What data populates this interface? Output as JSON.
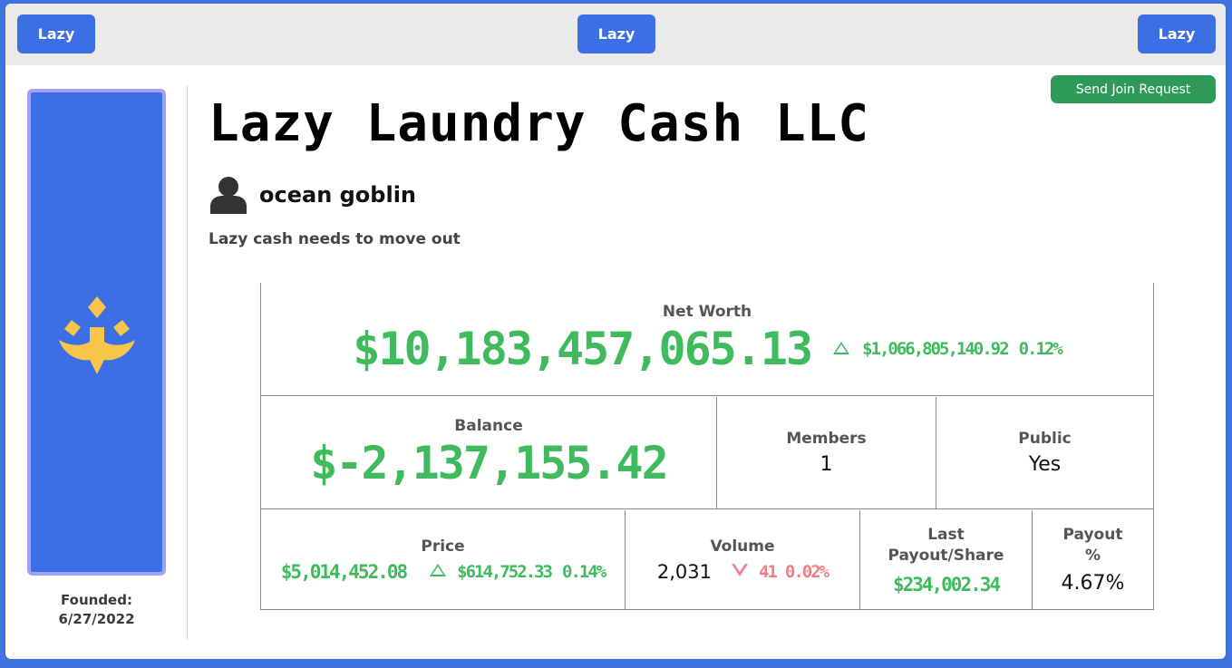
{
  "topbar": {
    "left_button": "Lazy",
    "middle_button": "Lazy",
    "right_button": "Lazy"
  },
  "join_button": "Send Join Request",
  "company": {
    "name": "Lazy Laundry Cash LLC",
    "owner": "ocean goblin",
    "tagline": "Lazy cash needs to move out",
    "founded_label": "Founded:",
    "founded_date": "6/27/2022",
    "logo_icon": "trident-icon",
    "logo_color": "#f8c44a",
    "card_color": "#3b6fe3"
  },
  "stats": {
    "net_worth": {
      "label": "Net Worth",
      "value": "$10,183,457,065.13",
      "change": "$1,066,805,140.92",
      "change_pct": "0.12%",
      "direction": "up"
    },
    "balance": {
      "label": "Balance",
      "value": "$-2,137,155.42"
    },
    "members": {
      "label": "Members",
      "value": "1"
    },
    "public": {
      "label": "Public",
      "value": "Yes"
    },
    "price": {
      "label": "Price",
      "value": "$5,014,452.08",
      "change": "$614,752.33",
      "change_pct": "0.14%",
      "direction": "up"
    },
    "volume": {
      "label": "Volume",
      "value": "2,031",
      "change": "41",
      "change_pct": "0.02%",
      "direction": "down"
    },
    "last_payout": {
      "label": "Last Payout/Share",
      "value": "$234,002.34"
    },
    "payout_pct": {
      "label": "Payout %",
      "value": "4.67%"
    }
  },
  "colors": {
    "positive": "#3fba5c",
    "negative": "#f07f87",
    "button_blue": "#3b6fe3",
    "join_green": "#2e9a5a"
  }
}
